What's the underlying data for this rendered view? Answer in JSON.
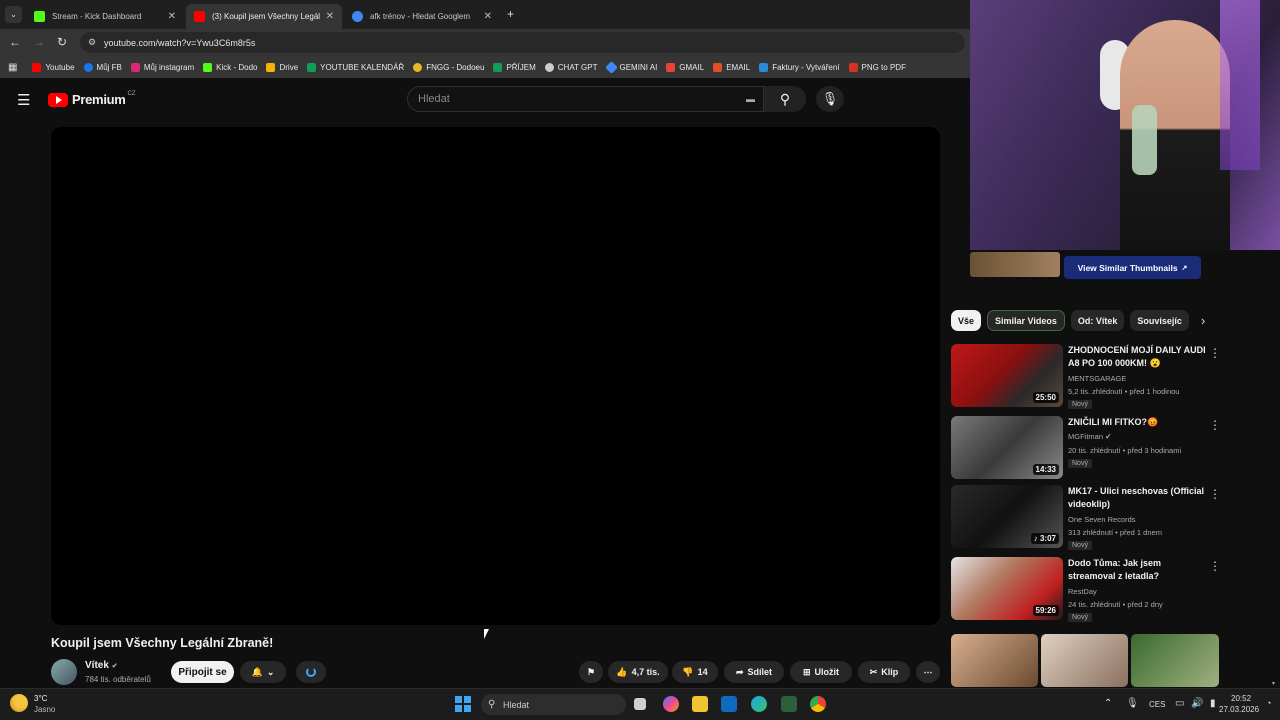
{
  "browser": {
    "tabs": [
      {
        "label": "Stream - Kick Dashboard",
        "color": "#53fc18"
      },
      {
        "label": "(3) Koupil jsem Všechny Legáln",
        "color": "#ff0000"
      },
      {
        "label": "afk trénov - Hledat Googlem",
        "color": "#4285f4"
      }
    ],
    "new_tab": "+",
    "url": "youtube.com/watch?v=Ywu3C6m8r5s",
    "bookmarks": [
      {
        "label": "Youtube",
        "color": "#ff0000"
      },
      {
        "label": "Můj FB",
        "color": "#1877f2"
      },
      {
        "label": "Můj instagram",
        "color": "#d62976"
      },
      {
        "label": "Kick - Dodo",
        "color": "#53fc18"
      },
      {
        "label": "Drive",
        "color": "#f4b400"
      },
      {
        "label": "YOUTUBE KALENDÁŘ",
        "color": "#0f9d58"
      },
      {
        "label": "FNGG - Dodoeu",
        "color": "#e8b923"
      },
      {
        "label": "PŘÍJEM",
        "color": "#0f9d58"
      },
      {
        "label": "CHAT GPT",
        "color": "#cccccc"
      },
      {
        "label": "GEMINI AI",
        "color": "#4285f4"
      },
      {
        "label": "GMAIL",
        "color": "#ea4335"
      },
      {
        "label": "EMAIL",
        "color": "#e34c26"
      },
      {
        "label": "Faktury - Vytváření",
        "color": "#2a8cd3"
      },
      {
        "label": "PNG to PDF",
        "color": "#d93025"
      }
    ]
  },
  "youtube": {
    "logo_text": "Premium",
    "region": "CZ",
    "search_placeholder": "Hledat",
    "video_title": "Koupil jsem Všechny Legální Zbraně!",
    "channel_name": "Vítek",
    "subscribers": "784 tis. odběratelů",
    "join_label": "Připojit se",
    "likes": "4,7 tis.",
    "dislikes": "14",
    "share_label": "Sdílet",
    "save_label": "Uložit",
    "clip_label": "Klip",
    "view_similar": "View Similar Thumbnails",
    "chips": [
      "Vše",
      "Similar Videos",
      "Od: Vítek",
      "Souvisejíc"
    ],
    "related": [
      {
        "title": "ZHODNOCENÍ MOJÍ DAILY AUDI A8 PO 100 000KM! 😮",
        "channel": "MENTSGARAGE",
        "meta": "5,2 tis. zhlédnutí • před 1 hodinou",
        "badge": "Nový",
        "duration": "25:50",
        "color1": "#c01818",
        "color2": "#3a3a3a"
      },
      {
        "title": "ZNIČILI MI FITKO?😡",
        "channel": "MGFitman",
        "meta": "20 tis. zhlédnutí • před 3 hodinami",
        "badge": "Nový",
        "duration": "14:33",
        "color1": "#6b6b6b",
        "color2": "#2b2b2b"
      },
      {
        "title": "MK17 - Ulici neschovas (Official videoklip)",
        "channel": "One Seven Records",
        "meta": "313 zhlédnutí • před 1 dnem",
        "badge": "Nový",
        "duration": "3:07",
        "color1": "#1c1c1c",
        "color2": "#555555"
      },
      {
        "title": "Dodo Tůma: Jak jsem streamoval z letadla?",
        "channel": "RestDay",
        "meta": "24 tis. zhlédnutí • před 2 dny",
        "badge": "Nový",
        "duration": "59:26",
        "color1": "#8a5a40",
        "color2": "#d8d8d8"
      }
    ]
  },
  "taskbar": {
    "weather_temp": "3°C",
    "weather_desc": "Jasno",
    "search_placeholder": "Hledat",
    "language": "CES",
    "time": "20:52",
    "date": "27.03.2026"
  }
}
